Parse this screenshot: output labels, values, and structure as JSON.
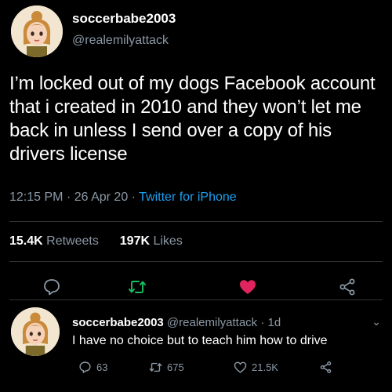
{
  "tweet": {
    "display_name": "soccerbabe2003",
    "handle": "@realemilyattack",
    "text": "I’m locked out of my dogs Facebook account that i created in 2010 and they won’t let me back in unless I send over a copy of his drivers license",
    "time": "12:15 PM",
    "date": "26 Apr 20",
    "separator": "·",
    "source": "Twitter for iPhone",
    "retweets_count": "15.4K",
    "retweets_label": "Retweets",
    "likes_count": "197K",
    "likes_label": "Likes",
    "actions": [
      "reply-icon",
      "retweet-icon",
      "like-icon",
      "share-icon"
    ],
    "liked": true
  },
  "reply": {
    "display_name": "soccerbabe2003",
    "handle": "@realemilyattack",
    "separator": "·",
    "age": "1d",
    "text": "I have no choice but to teach him how to drive",
    "reply_count": "63",
    "retweet_count": "675",
    "like_count": "21.5K"
  },
  "colors": {
    "background": "#000000",
    "text": "#ffffff",
    "secondary": "#8b98a5",
    "link": "#1da1f2",
    "retweet": "#17bf63",
    "like": "#e0245e"
  }
}
